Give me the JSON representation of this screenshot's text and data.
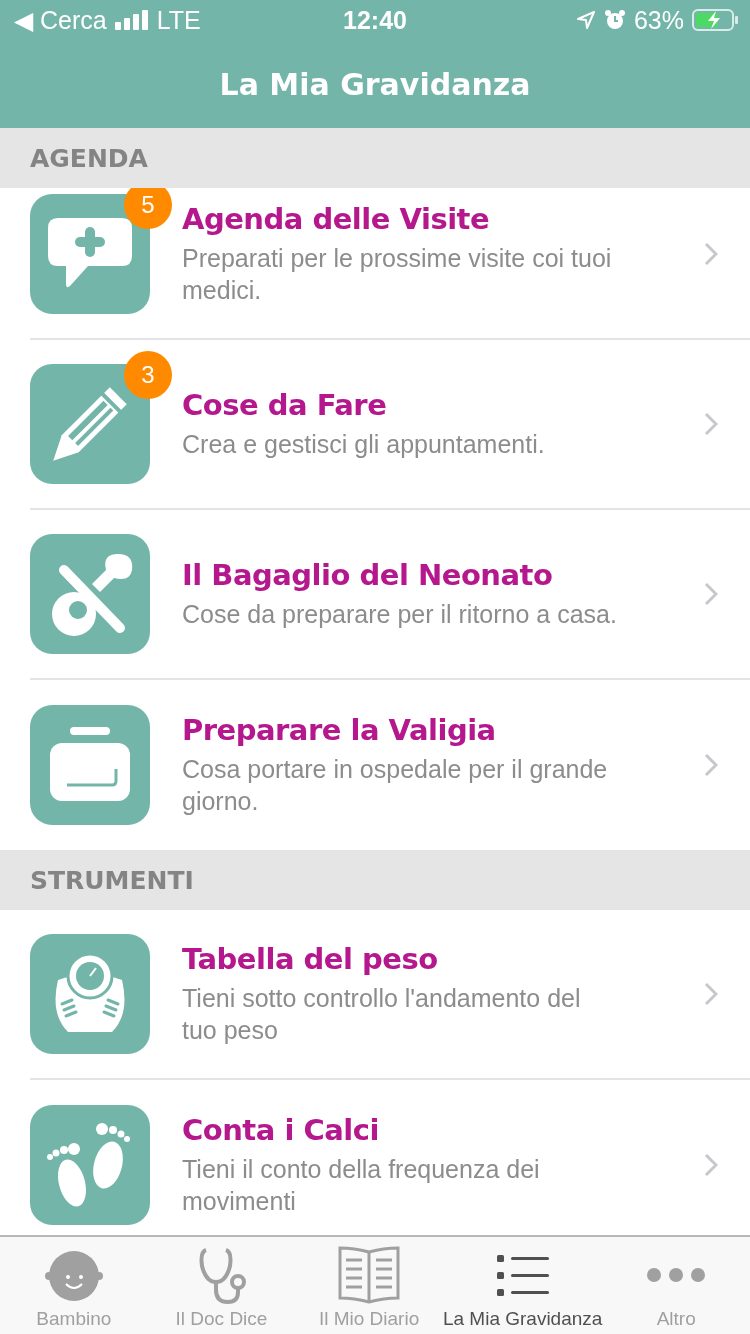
{
  "status_bar": {
    "back": "◀ Cerca",
    "network": "LTE",
    "time": "12:40",
    "battery": "63%"
  },
  "nav_bar": {
    "title": "La Mia Gravidanza"
  },
  "sections": [
    {
      "header": "AGENDA",
      "items": [
        {
          "badge": "5",
          "title": "Agenda delle Visite",
          "subtitle": "Preparati per le prossime visite coi tuoi medici."
        },
        {
          "badge": "3",
          "title": "Cose da Fare",
          "subtitle": "Crea e gestisci gli appuntamenti."
        },
        {
          "title": "Il Bagaglio del Neonato",
          "subtitle": "Cose da preparare per il ritorno a casa."
        },
        {
          "title": "Preparare la Valigia",
          "subtitle": "Cosa portare in ospedale per il grande giorno."
        }
      ]
    },
    {
      "header": "STRUMENTI",
      "items": [
        {
          "title": "Tabella del peso",
          "subtitle": "Tieni sotto controllo l'andamento del tuo peso"
        },
        {
          "title": "Conta i Calci",
          "subtitle": "Tieni il conto della frequenza dei movimenti"
        }
      ]
    }
  ],
  "tab_bar": [
    {
      "label": "Bambino",
      "selected": false
    },
    {
      "label": "Il Doc Dice",
      "selected": false
    },
    {
      "label": "Il Mio Diario",
      "selected": false
    },
    {
      "label": "La Mia Gravidanza",
      "selected": true
    },
    {
      "label": "Altro",
      "selected": false
    }
  ]
}
